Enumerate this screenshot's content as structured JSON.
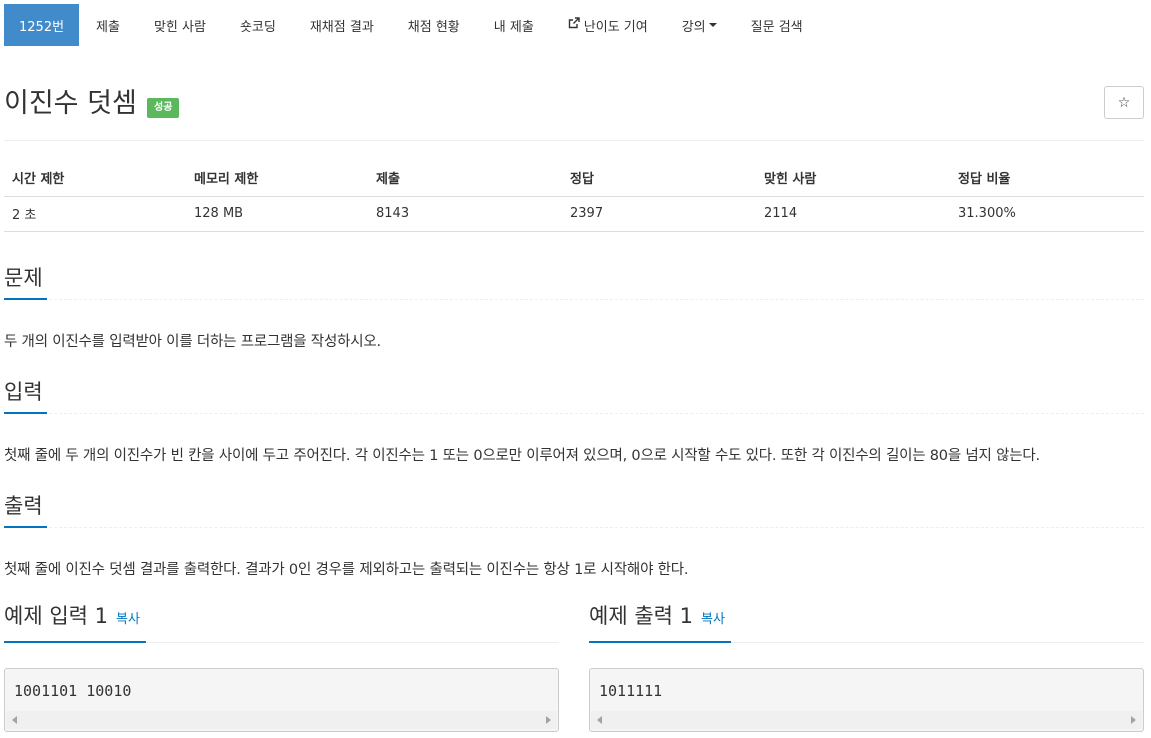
{
  "nav": {
    "items": [
      {
        "label": "1252번"
      },
      {
        "label": "제출"
      },
      {
        "label": "맞힌 사람"
      },
      {
        "label": "숏코딩"
      },
      {
        "label": "재채점 결과"
      },
      {
        "label": "채점 현황"
      },
      {
        "label": "내 제출"
      },
      {
        "label": "난이도 기여",
        "icon": "external-link-icon"
      },
      {
        "label": "강의",
        "icon": "caret-down-icon"
      },
      {
        "label": "질문 검색"
      }
    ],
    "active_index": 0,
    "active_color": "#428bca"
  },
  "problem": {
    "title": "이진수 덧셈",
    "badge": "성공",
    "badge_color": "#5cb85c",
    "star_icon": "star-outline-icon",
    "star_glyph": "☆"
  },
  "info": {
    "headers": [
      "시간 제한",
      "메모리 제한",
      "제출",
      "정답",
      "맞힌 사람",
      "정답 비율"
    ],
    "values": [
      "2 초",
      "128 MB",
      "8143",
      "2397",
      "2114",
      "31.300%"
    ]
  },
  "sections": {
    "problem": {
      "heading": "문제",
      "text": "두 개의 이진수를 입력받아 이를 더하는 프로그램을 작성하시오."
    },
    "input": {
      "heading": "입력",
      "text": "첫째 줄에 두 개의 이진수가 빈 칸을 사이에 두고 주어진다. 각 이진수는 1 또는 0으로만 이루어져 있으며, 0으로 시작할 수도 있다. 또한 각 이진수의 길이는 80을 넘지 않는다."
    },
    "output": {
      "heading": "출력",
      "text": "첫째 줄에 이진수 덧셈 결과를 출력한다. 결과가 0인 경우를 제외하고는 출력되는 이진수는 항상 1로 시작해야 한다."
    }
  },
  "examples": {
    "input": {
      "heading": "예제 입력 1",
      "copy": "복사",
      "value": "1001101 10010"
    },
    "output": {
      "heading": "예제 출력 1",
      "copy": "복사",
      "value": "1011111"
    }
  },
  "accent_color": "#0076c0"
}
